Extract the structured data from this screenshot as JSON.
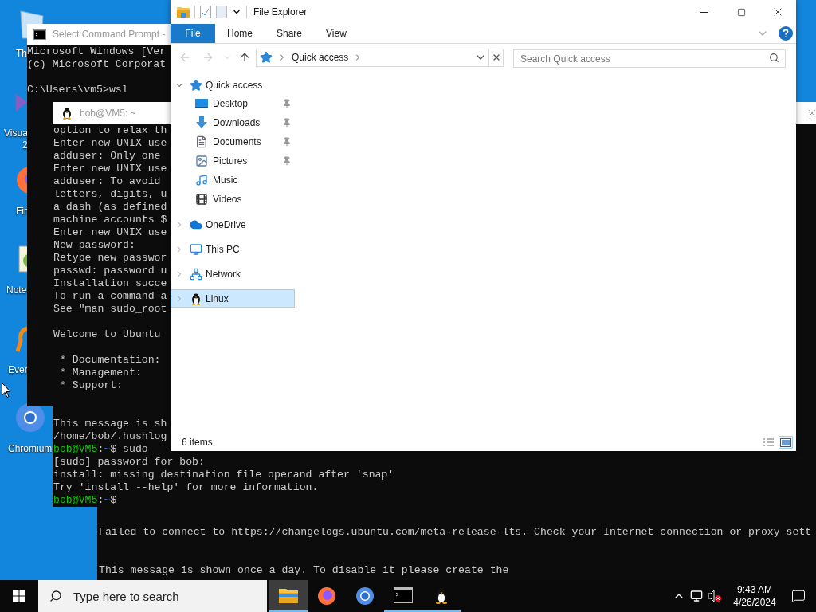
{
  "desktop_icons": [
    {
      "kind": "recycle",
      "lines": [
        "Th"
      ]
    },
    {
      "kind": "studio",
      "lines": [
        "Visua",
        "2"
      ]
    },
    {
      "kind": "firefox",
      "lines": [
        "Fir"
      ]
    },
    {
      "kind": "notepad",
      "lines": [
        "Note"
      ]
    },
    {
      "kind": "everything",
      "lines": [
        "Ever"
      ]
    },
    {
      "kind": "chromium",
      "lines": [
        "Chromium"
      ]
    }
  ],
  "back_terminal": {
    "lines": [
      {
        "kind": "blank"
      },
      {
        "kind": "blank"
      },
      {
        "kind": "text",
        "text": "Failed to connect to https://changelogs.ubuntu.com/meta-release-lts. Check your Internet connection or proxy sett"
      },
      {
        "kind": "blank"
      },
      {
        "kind": "blank"
      },
      {
        "kind": "text",
        "text": "This message is shown once a day. To disable it please create the"
      }
    ]
  },
  "cmd_window": {
    "title": "Select Command Prompt -",
    "lines": [
      {
        "kind": "text",
        "text": "Microsoft Windows [Ver"
      },
      {
        "kind": "text",
        "text": "(c) Microsoft Corporat"
      },
      {
        "kind": "blank"
      },
      {
        "kind": "text",
        "text": "C:\\Users\\vm5>wsl"
      }
    ]
  },
  "wsl_window": {
    "title": "bob@VM5: ~",
    "lines": [
      {
        "kind": "text",
        "text": "option to relax th"
      },
      {
        "kind": "text",
        "text": "Enter new UNIX use"
      },
      {
        "kind": "text",
        "text": "adduser: Only one"
      },
      {
        "kind": "text",
        "text": "Enter new UNIX use"
      },
      {
        "kind": "text",
        "text": "adduser: To avoid"
      },
      {
        "kind": "text",
        "text": "letters, digits, u"
      },
      {
        "kind": "text",
        "text": "a dash (as defined"
      },
      {
        "kind": "text",
        "text": "machine accounts $"
      },
      {
        "kind": "text",
        "text": "Enter new UNIX use"
      },
      {
        "kind": "text",
        "text": "New password:"
      },
      {
        "kind": "text",
        "text": "Retype new passwor"
      },
      {
        "kind": "text",
        "text": "passwd: password u"
      },
      {
        "kind": "text",
        "text": "Installation succe"
      },
      {
        "kind": "text",
        "text": "To run a command a"
      },
      {
        "kind": "text",
        "text": "See \"man sudo_root"
      },
      {
        "kind": "blank"
      },
      {
        "kind": "text",
        "text": "Welcome to Ubuntu"
      },
      {
        "kind": "blank"
      },
      {
        "kind": "text",
        "text": " * Documentation:"
      },
      {
        "kind": "text",
        "text": " * Management:"
      },
      {
        "kind": "text",
        "text": " * Support:"
      },
      {
        "kind": "blank"
      },
      {
        "kind": "blank"
      },
      {
        "kind": "text",
        "text": "This message is sh"
      },
      {
        "kind": "text",
        "text": "/home/bob/.hushlog"
      },
      {
        "kind": "prompt",
        "segments": [
          {
            "kind": "user",
            "text": "bob@VM5"
          },
          {
            "kind": "plain",
            "text": ":"
          },
          {
            "kind": "path",
            "text": "~"
          },
          {
            "kind": "plain",
            "text": "$ sudo"
          }
        ]
      },
      {
        "kind": "text",
        "text": "[sudo] password for bob:"
      },
      {
        "kind": "text",
        "text": "install: missing destination file operand after 'snap'"
      },
      {
        "kind": "text",
        "text": "Try 'install --help' for more information."
      },
      {
        "kind": "prompt",
        "segments": [
          {
            "kind": "user",
            "text": "bob@VM5"
          },
          {
            "kind": "plain",
            "text": ":"
          },
          {
            "kind": "path",
            "text": "~"
          },
          {
            "kind": "plain",
            "text": "$"
          }
        ]
      }
    ]
  },
  "explorer": {
    "title": "File Explorer",
    "ribbon_tabs": [
      {
        "kind": "menu",
        "label": "File"
      },
      {
        "kind": "tab",
        "label": "Home"
      },
      {
        "kind": "tab",
        "label": "Share"
      },
      {
        "kind": "tab",
        "label": "View"
      }
    ],
    "address": {
      "location": "Quick access"
    },
    "search": {
      "placeholder": "Search Quick access"
    },
    "nav_pane": [
      {
        "kind": "star",
        "label": "Quick access",
        "expanded": true,
        "selected": false,
        "children": [
          {
            "kind": "desktop",
            "label": "Desktop",
            "pinned": true
          },
          {
            "kind": "downloads",
            "label": "Downloads",
            "pinned": true
          },
          {
            "kind": "documents",
            "label": "Documents",
            "pinned": true
          },
          {
            "kind": "pictures",
            "label": "Pictures",
            "pinned": true
          },
          {
            "kind": "music",
            "label": "Music",
            "pinned": false
          },
          {
            "kind": "videos",
            "label": "Videos",
            "pinned": false
          }
        ]
      },
      {
        "kind": "cloud",
        "label": "OneDrive",
        "expanded": false,
        "selected": false
      },
      {
        "kind": "pc",
        "label": "This PC",
        "expanded": false,
        "selected": false
      },
      {
        "kind": "network",
        "label": "Network",
        "expanded": false,
        "selected": false
      },
      {
        "kind": "linux",
        "label": "Linux",
        "expanded": false,
        "selected": true
      }
    ],
    "status_bar": {
      "item_count": "6 items",
      "views": [
        {
          "kind": "details",
          "selected": false
        },
        {
          "kind": "large",
          "selected": true
        }
      ]
    }
  },
  "taskbar": {
    "search_placeholder": "Type here to search",
    "apps": [
      {
        "kind": "explorer",
        "active": true,
        "running": true
      },
      {
        "kind": "firefox",
        "active": false,
        "running": false
      },
      {
        "kind": "chromium",
        "active": false,
        "running": false
      },
      {
        "kind": "console",
        "active": false,
        "running": true
      },
      {
        "kind": "linux",
        "active": false,
        "running": true
      }
    ],
    "volume_muted": true,
    "clock": {
      "time": "9:43 AM",
      "date": "4/26/2024"
    }
  }
}
